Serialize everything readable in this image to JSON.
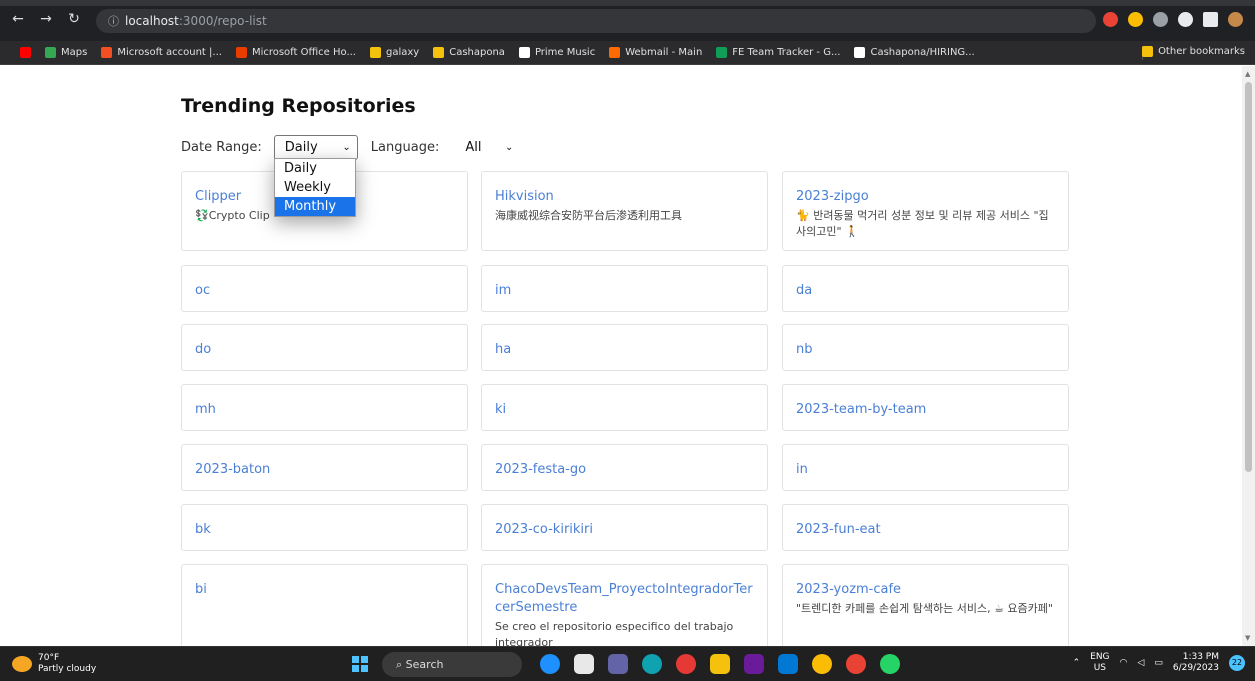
{
  "browser": {
    "url_host": "localhost",
    "url_rest": ":3000/repo-list",
    "bookmarks": [
      {
        "label": "Maps",
        "color": "#34a853"
      },
      {
        "label": "Microsoft account |...",
        "color": "#f25022"
      },
      {
        "label": "Microsoft Office Ho...",
        "color": "#eb3c00"
      },
      {
        "label": "galaxy",
        "color": "#f4c20d"
      },
      {
        "label": "Cashapona",
        "color": "#f4c20d"
      },
      {
        "label": "Prime Music",
        "color": "#ffffff"
      },
      {
        "label": "Webmail - Main",
        "color": "#ff6a00"
      },
      {
        "label": "FE Team Tracker - G...",
        "color": "#0f9d58"
      },
      {
        "label": "Cashapona/HIRING...",
        "color": "#ffffff"
      }
    ],
    "other_bookmarks": "Other bookmarks"
  },
  "page": {
    "title": "Trending Repositories",
    "date_label": "Date Range:",
    "date_value": "Daily",
    "language_label": "Language:",
    "language_value": "All",
    "date_options": [
      "Daily",
      "Weekly",
      "Monthly"
    ],
    "date_selected_index": 2
  },
  "repos": [
    {
      "name": "Clipper",
      "desc": "💱Crypto Clip"
    },
    {
      "name": "Hikvision",
      "desc": "海康威视综合安防平台后渗透利用工具"
    },
    {
      "name": "2023-zipgo",
      "desc": "🐈 반려동물 먹거리 성분 정보 및 리뷰 제공 서비스 \"집사의고민\" 🚶"
    },
    {
      "name": "oc",
      "desc": ""
    },
    {
      "name": "im",
      "desc": ""
    },
    {
      "name": "da",
      "desc": ""
    },
    {
      "name": "do",
      "desc": ""
    },
    {
      "name": "ha",
      "desc": ""
    },
    {
      "name": "nb",
      "desc": ""
    },
    {
      "name": "mh",
      "desc": ""
    },
    {
      "name": "ki",
      "desc": ""
    },
    {
      "name": "2023-team-by-team",
      "desc": ""
    },
    {
      "name": "2023-baton",
      "desc": ""
    },
    {
      "name": "2023-festa-go",
      "desc": ""
    },
    {
      "name": "in",
      "desc": ""
    },
    {
      "name": "bk",
      "desc": ""
    },
    {
      "name": "2023-co-kirikiri",
      "desc": ""
    },
    {
      "name": "2023-fun-eat",
      "desc": ""
    },
    {
      "name": "bi",
      "desc": ""
    },
    {
      "name": "ChacoDevsTeam_ProyectoIntegradorTercerSemestre",
      "desc": "Se creo el repositorio especifico del trabajo integrador"
    },
    {
      "name": "2023-yozm-cafe",
      "desc": "\"트렌디한 카페를 손쉽게 탐색하는 서비스, ☕ 요즘카페\""
    }
  ],
  "taskbar": {
    "temp": "70°F",
    "weather": "Partly cloudy",
    "search": "Search",
    "lang1": "ENG",
    "lang2": "US",
    "time": "1:33 PM",
    "date": "6/29/2023",
    "notifications": "22"
  }
}
